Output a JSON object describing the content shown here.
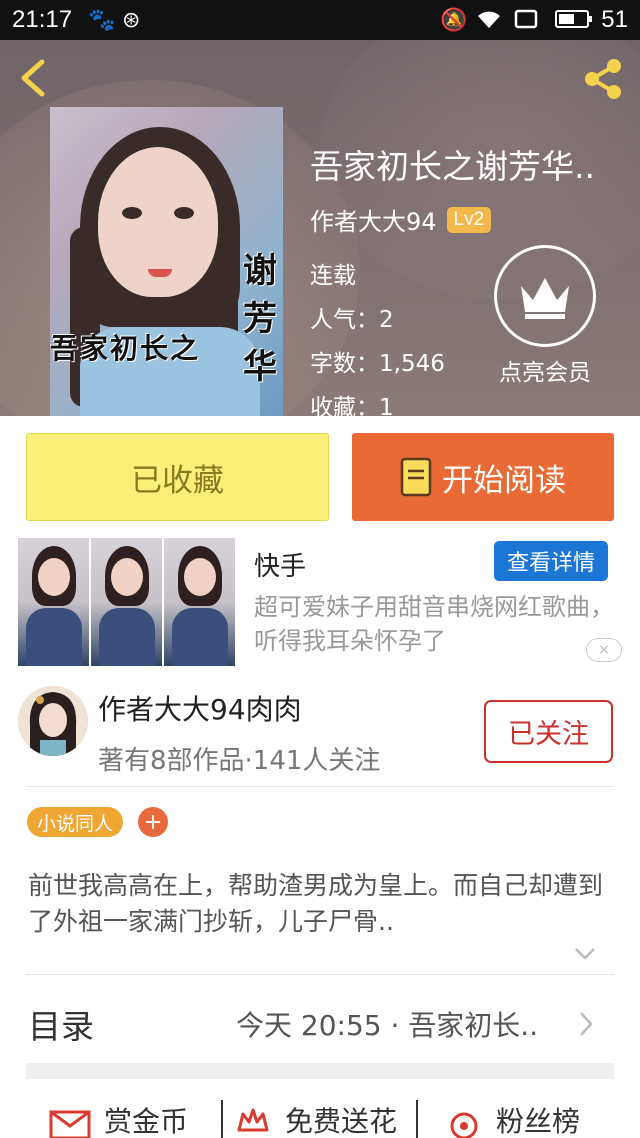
{
  "status_bar": {
    "time": "21:17",
    "battery": "51"
  },
  "book": {
    "title": "吾家初长之谢芳华..",
    "author": "作者大大94",
    "level": "Lv2",
    "status": "连载",
    "popularity": "人气：2",
    "word_count": "字数：1,546",
    "favorites": "收藏：1",
    "cover_text_horizontal": "吾家初长之",
    "cover_text_vertical": "谢芳华"
  },
  "member": {
    "label": "点亮会员"
  },
  "buttons": {
    "collected": "已收藏",
    "start_reading": "开始阅读"
  },
  "ad": {
    "title": "快手",
    "detail_label": "查看详情",
    "description": "超可爱妹子用甜音串烧网红歌曲，听得我耳朵怀孕了",
    "close_label": "×"
  },
  "author_card": {
    "name": "作者大大94肉肉",
    "stats": "著有8部作品·141人关注",
    "follow_label": "已关注"
  },
  "tags": {
    "items": [
      "小说同人"
    ],
    "add_label": "+"
  },
  "summary": {
    "text": "前世我高高在上，帮助渣男成为皇上。而自己却遭到了外祖一家满门抄斩，儿子尸骨.."
  },
  "toc": {
    "label": "目录",
    "latest": "今天 20:55 · 吾家初长.."
  },
  "actions": {
    "reward": "赏金币",
    "flowers": "免费送花",
    "fans": "粉丝榜"
  },
  "colors": {
    "accent_orange": "#ea6a35",
    "collected_yellow": "#f9ef79",
    "follow_red": "#c9322c",
    "detail_blue": "#1c76d6",
    "level_badge": "#f2b84b"
  },
  "icons": [
    "back-icon",
    "share-icon",
    "crown-icon",
    "book-icon",
    "close-icon",
    "chevron-down-icon",
    "chevron-right-icon",
    "envelope-icon",
    "flower-icon",
    "ranking-icon"
  ]
}
